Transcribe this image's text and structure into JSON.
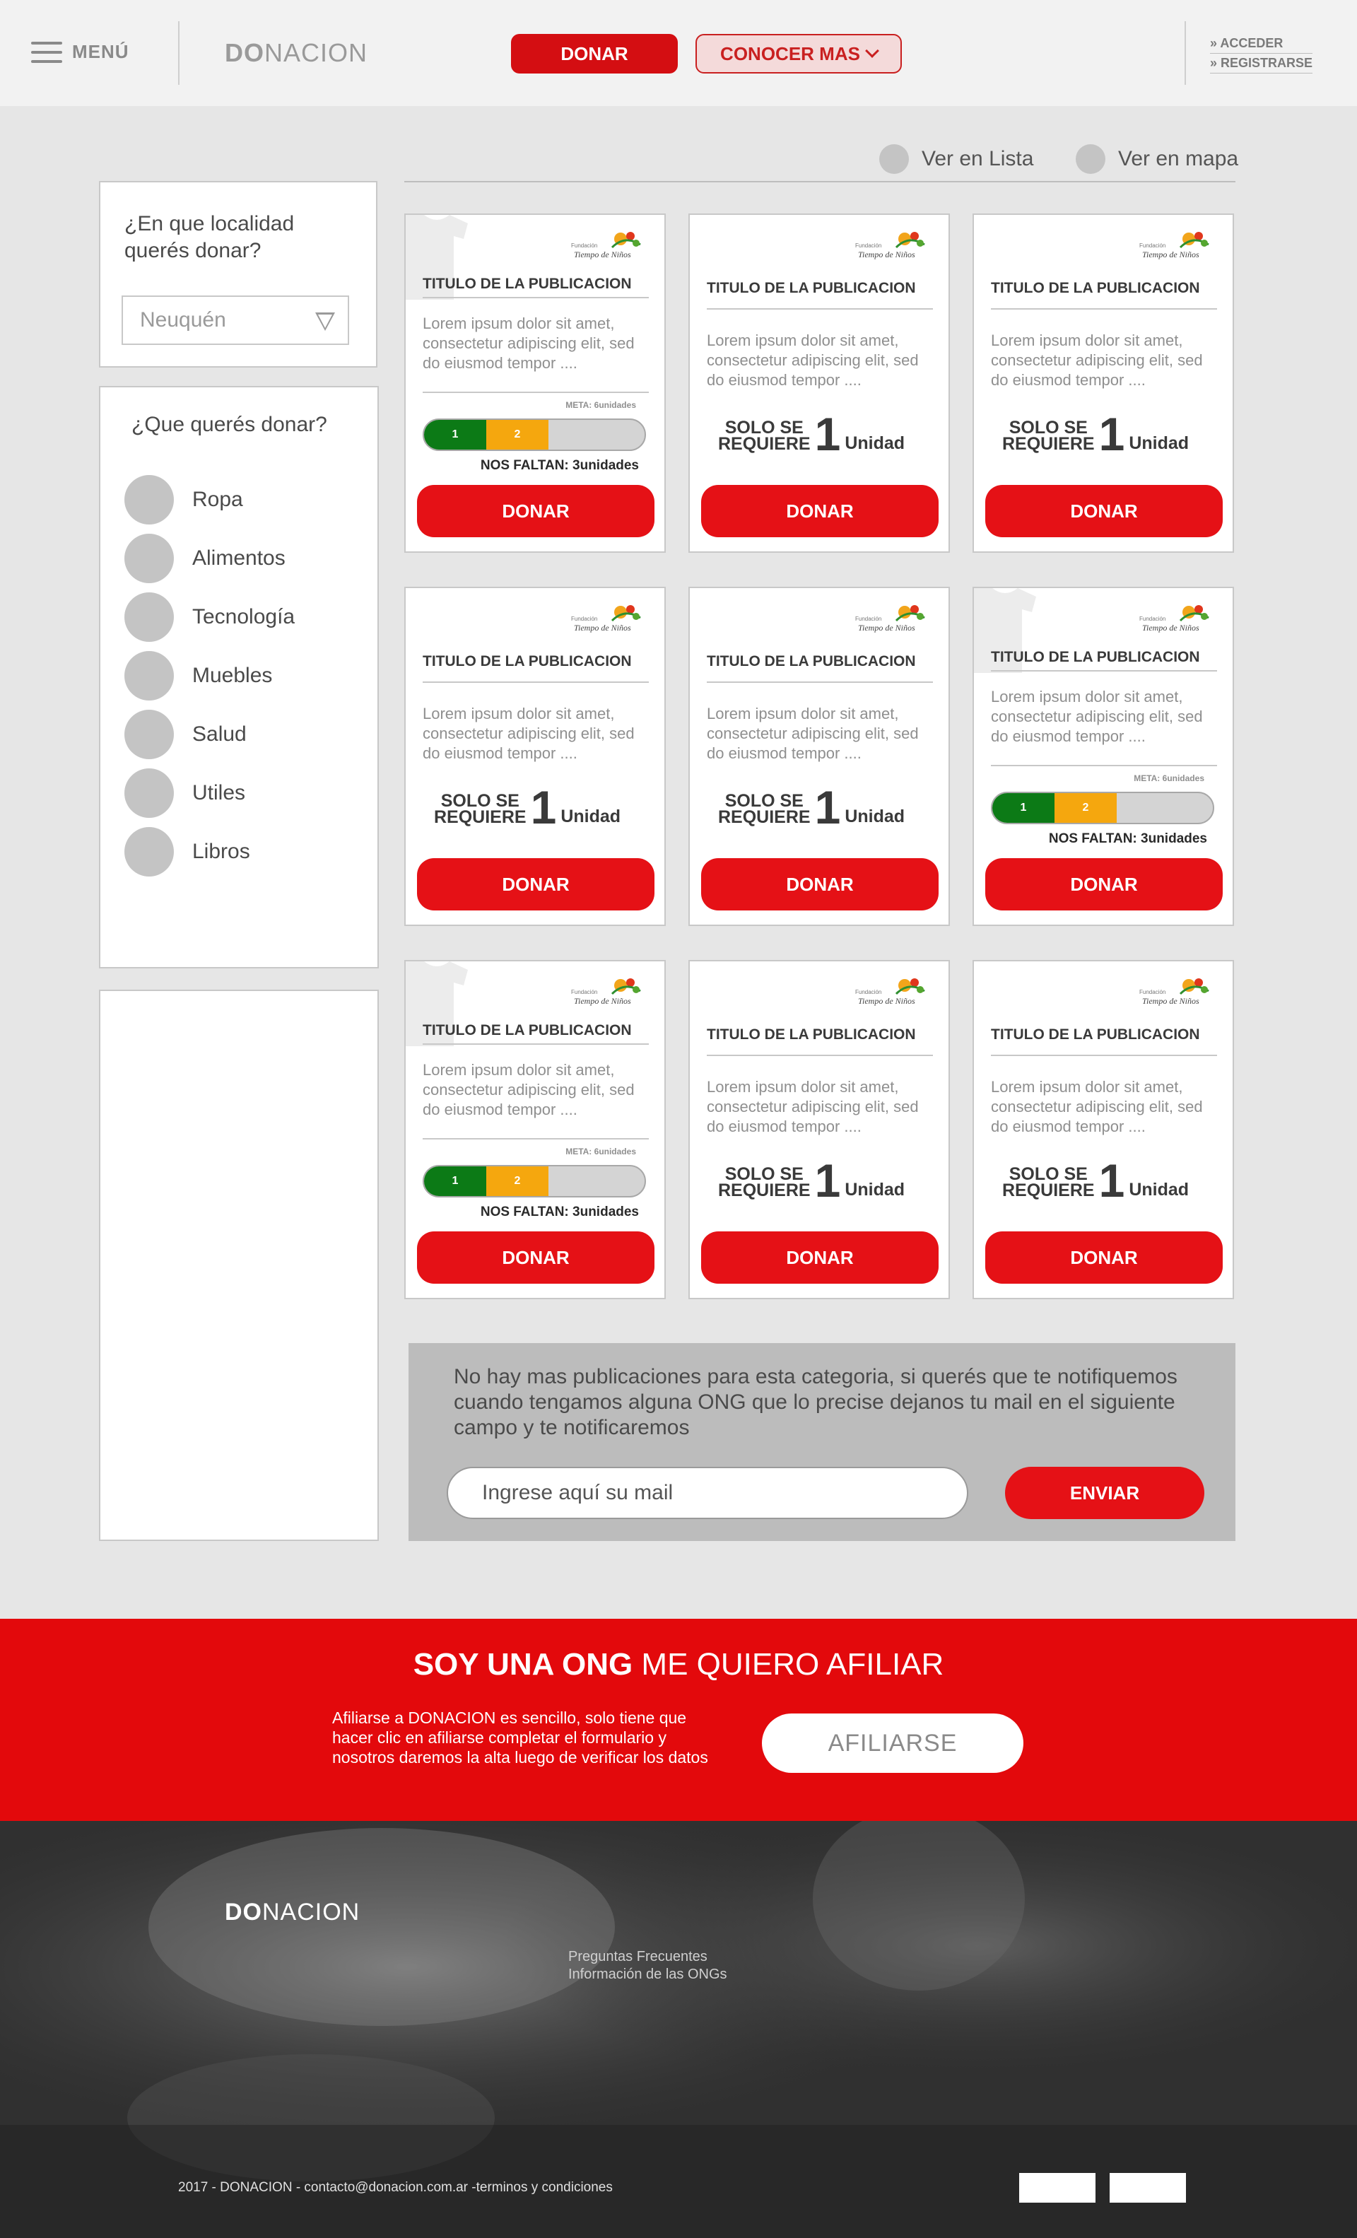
{
  "header": {
    "menu_label": "MENÚ",
    "logo_bold": "DO",
    "logo_rest": "NACION",
    "donar_label": "DONAR",
    "conocer_label": "CONOCER MAS",
    "acceder_label": "» ACCEDER",
    "registrarse_label": "» REGISTRARSE"
  },
  "view_toggle": {
    "list_label": "Ver en Lista",
    "map_label": "Ver en mapa"
  },
  "sidebar": {
    "location_question": "¿En que localidad querés donar?",
    "location_value": "Neuquén",
    "category_question": "¿Que querés donar?",
    "categories": [
      "Ropa",
      "Alimentos",
      "Tecnología",
      "Muebles",
      "Salud",
      "Utiles",
      "Libros"
    ]
  },
  "cards": [
    {
      "type": "progress",
      "title": "TITULO DE LA PUBLICACION",
      "desc": "Lorem ipsum dolor sit amet, consectetur adipiscing elit, sed do eiusmod tempor ....",
      "meta": "META: 6unidades",
      "progress_labels": [
        "1",
        "2"
      ],
      "progress_fraction": 0.33,
      "faltan": "NOS FALTAN: 3unidades",
      "button": "DONAR"
    },
    {
      "type": "solo",
      "title": "TITULO DE LA PUBLICACION",
      "desc": "Lorem ipsum dolor sit amet, consectetur adipiscing elit, sed do eiusmod tempor ....",
      "solo_line1": "SOLO SE",
      "solo_line2": "REQUIERE",
      "qty": "1",
      "unit": "Unidad",
      "button": "DONAR"
    },
    {
      "type": "solo",
      "title": "TITULO DE LA PUBLICACION",
      "desc": "Lorem ipsum dolor sit amet, consectetur adipiscing elit, sed do eiusmod tempor ....",
      "solo_line1": "SOLO SE",
      "solo_line2": "REQUIERE",
      "qty": "1",
      "unit": "Unidad",
      "button": "DONAR"
    },
    {
      "type": "solo",
      "title": "TITULO DE LA PUBLICACION",
      "desc": "Lorem ipsum dolor sit amet, consectetur adipiscing elit, sed do eiusmod tempor ....",
      "solo_line1": "SOLO SE",
      "solo_line2": "REQUIERE",
      "qty": "1",
      "unit": "Unidad",
      "button": "DONAR"
    },
    {
      "type": "solo",
      "title": "TITULO DE LA PUBLICACION",
      "desc": "Lorem ipsum dolor sit amet, consectetur adipiscing elit, sed do eiusmod tempor ....",
      "solo_line1": "SOLO SE",
      "solo_line2": "REQUIERE",
      "qty": "1",
      "unit": "Unidad",
      "button": "DONAR"
    },
    {
      "type": "progress",
      "title": "TITULO DE LA PUBLICACION",
      "desc": "Lorem ipsum dolor sit amet, consectetur adipiscing elit, sed do eiusmod tempor ....",
      "meta": "META: 6unidades",
      "progress_labels": [
        "1",
        "2"
      ],
      "progress_fraction": 0.33,
      "faltan": "NOS FALTAN: 3unidades",
      "button": "DONAR"
    },
    {
      "type": "progress",
      "title": "TITULO DE LA PUBLICACION",
      "desc": "Lorem ipsum dolor sit amet, consectetur adipiscing elit, sed do eiusmod tempor ....",
      "meta": "META: 6unidades",
      "progress_labels": [
        "1",
        "2"
      ],
      "progress_fraction": 0.33,
      "faltan": "NOS FALTAN: 3unidades",
      "button": "DONAR"
    },
    {
      "type": "solo",
      "title": "TITULO DE LA PUBLICACION",
      "desc": "Lorem ipsum dolor sit amet, consectetur adipiscing elit, sed do eiusmod tempor ....",
      "solo_line1": "SOLO SE",
      "solo_line2": "REQUIERE",
      "qty": "1",
      "unit": "Unidad",
      "button": "DONAR"
    },
    {
      "type": "solo",
      "title": "TITULO DE LA PUBLICACION",
      "desc": "Lorem ipsum dolor sit amet, consectetur adipiscing elit, sed do eiusmod tempor ....",
      "solo_line1": "SOLO SE",
      "solo_line2": "REQUIERE",
      "qty": "1",
      "unit": "Unidad",
      "button": "DONAR"
    }
  ],
  "notify": {
    "text": "No hay mas publicaciones para esta categoria, si querés que te notifiquemos cuando tengamos alguna ONG que lo precise dejanos tu mail en el siguiente campo y te notificaremos",
    "input_placeholder": "Ingrese aquí su mail",
    "button": "ENVIAR"
  },
  "ong_banner": {
    "title_bold": "SOY UNA ONG",
    "title_rest": " ME QUIERO AFILIAR",
    "text": "Afiliarse a DONACION es sencillo, solo tiene que hacer clic en afiliarse completar el formulario y nosotros daremos la alta luego de verificar los datos",
    "button": "AFILIARSE"
  },
  "footer": {
    "logo_bold": "DO",
    "logo_rest": "NACION",
    "links": [
      "Preguntas Frecuentes",
      "Información de las ONGs"
    ],
    "copyright": "2017 - DONACION - contacto@donacion.com.ar -terminos y condiciones"
  },
  "colors": {
    "brand_red": "#e51116",
    "progress_green": "#0c7a16",
    "progress_orange": "#f5a70e"
  },
  "icons": [
    "hamburger-icon",
    "chevron-down-icon",
    "dropdown-triangle-icon",
    "shirt-icon",
    "org-logo"
  ]
}
